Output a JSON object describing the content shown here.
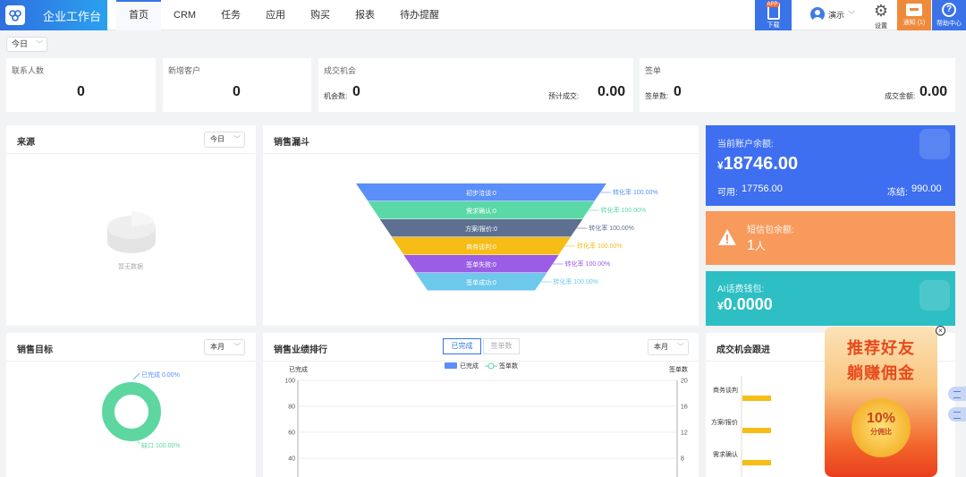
{
  "app": {
    "title": "企业工作台"
  },
  "nav": {
    "items": [
      "首页",
      "CRM",
      "任务",
      "应用",
      "购买",
      "报表",
      "待办提醒"
    ],
    "active_index": 0
  },
  "toolbar": {
    "download": {
      "badge": "APP",
      "label": "下载"
    },
    "user": {
      "name": "演示"
    },
    "settings_label": "设置",
    "notice_label": "通知 (1)",
    "help_label": "帮助中心"
  },
  "date_filter": {
    "value": "今日"
  },
  "stats": {
    "contacts": {
      "title": "联系人数",
      "value": "0"
    },
    "customers": {
      "title": "新增客户",
      "value": "0"
    },
    "opportunity": {
      "title": "成交机会",
      "count_label": "机会数:",
      "count": "0",
      "expected_label": "预计成交:",
      "expected": "0.00"
    },
    "signed": {
      "title": "签单",
      "count_label": "签单数:",
      "count": "0",
      "amount_label": "成交金额:",
      "amount": "0.00"
    }
  },
  "source_panel": {
    "title": "来源",
    "filter": "今日",
    "empty_text": "暂无数据"
  },
  "funnel_panel": {
    "title": "销售漏斗",
    "stages": [
      {
        "label": "初步洽谈:0",
        "rate": "转化率 100.00%",
        "color": "#5b8ff9"
      },
      {
        "label": "需求确认:0",
        "rate": "转化率 100.00%",
        "color": "#5ad8a6"
      },
      {
        "label": "方案/报价:0",
        "rate": "转化率 100.00%",
        "color": "#5d7092"
      },
      {
        "label": "商务谈判:0",
        "rate": "转化率 100.00%",
        "color": "#f6bd16"
      },
      {
        "label": "签单失败:0",
        "rate": "转化率 100.00%",
        "color": "#9b5de5"
      },
      {
        "label": "签单成功:0",
        "rate": "转化率 100.00%",
        "color": "#6dc8ec"
      }
    ]
  },
  "balance_card": {
    "label": "当前账户余额:",
    "currency": "¥",
    "amount": "18746.00",
    "available_label": "可用:",
    "available": "17756.00",
    "frozen_label": "冻结:",
    "frozen": "990.00",
    "color": "#3e6ff0"
  },
  "redpacket_card": {
    "label": "短信包余额:",
    "value": "1",
    "unit": "人",
    "color": "#f79a5c"
  },
  "ai_card": {
    "label": "AI话费钱包:",
    "currency": "¥",
    "amount": "0.0000",
    "color": "#2dbfc4"
  },
  "target_panel": {
    "title": "销售目标",
    "filter": "本月",
    "done_label": "已完成 0.00%",
    "gap_label": "缺口 100.00%",
    "color": "#5ed6a0"
  },
  "ranking_panel": {
    "title": "销售业绩排行",
    "filter": "本月",
    "tabs": [
      "已完成",
      "签单数"
    ],
    "active_tab": 0,
    "legend": [
      "已完成",
      "签单数"
    ],
    "left_axis_title": "已完成",
    "right_axis_title": "签单数"
  },
  "progress_panel": {
    "title": "成交机会跟进"
  },
  "promo": {
    "line1": "推荐好友",
    "line2": "躺赚佣金",
    "percent": "10%",
    "sub": "分佣比"
  },
  "chart_data": [
    {
      "type": "bar",
      "title": "销售漏斗",
      "categories": [
        "初步洽谈",
        "需求确认",
        "方案/报价",
        "商务谈判",
        "签单失败",
        "签单成功"
      ],
      "values": [
        0,
        0,
        0,
        0,
        0,
        0
      ],
      "conversion_rates": [
        100,
        100,
        100,
        100,
        100,
        100
      ]
    },
    {
      "type": "pie",
      "title": "销售目标",
      "categories": [
        "已完成",
        "缺口"
      ],
      "values": [
        0,
        100
      ]
    },
    {
      "type": "bar",
      "title": "销售业绩排行",
      "series": [
        {
          "name": "已完成",
          "values": []
        },
        {
          "name": "签单数",
          "values": []
        }
      ],
      "ylabel": "已完成",
      "ylim": [
        0,
        100
      ],
      "y_ticks": [
        100,
        80,
        60,
        40
      ],
      "y2label": "签单数",
      "y2lim": [
        0,
        20
      ],
      "y2_ticks": [
        20,
        16,
        12,
        8
      ],
      "grid": true,
      "legend": "top"
    },
    {
      "type": "bar",
      "title": "成交机会跟进",
      "categories": [
        "商务谈判",
        "方案/报价",
        "需求确认"
      ],
      "values": [
        1,
        1,
        1
      ],
      "color": "#f6bd16"
    }
  ]
}
